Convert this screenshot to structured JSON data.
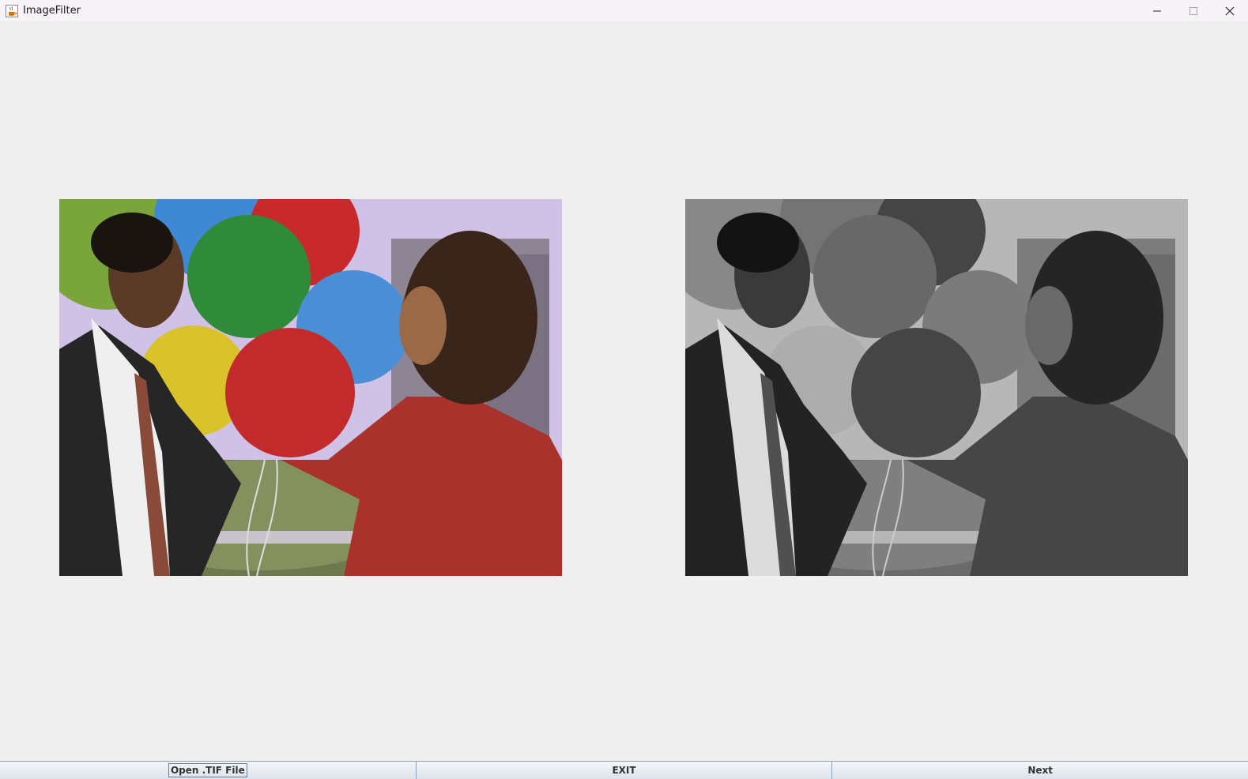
{
  "window": {
    "title": "ImageFilter",
    "icon": "java-cup-icon",
    "controls": [
      "minimize-icon",
      "maximize-icon",
      "close-icon"
    ]
  },
  "images": {
    "original": {
      "icon": "photo-couple-balloons",
      "mode": "color"
    },
    "filtered": {
      "icon": "photo-couple-balloons",
      "mode": "grayscale"
    }
  },
  "buttons": {
    "open": "Open .TIF File",
    "exit": "EXIT",
    "next": "Next"
  },
  "colors": {
    "background": "#efefef",
    "titlebar": "#f8f3f8",
    "button_border": "#8aa1b8"
  }
}
